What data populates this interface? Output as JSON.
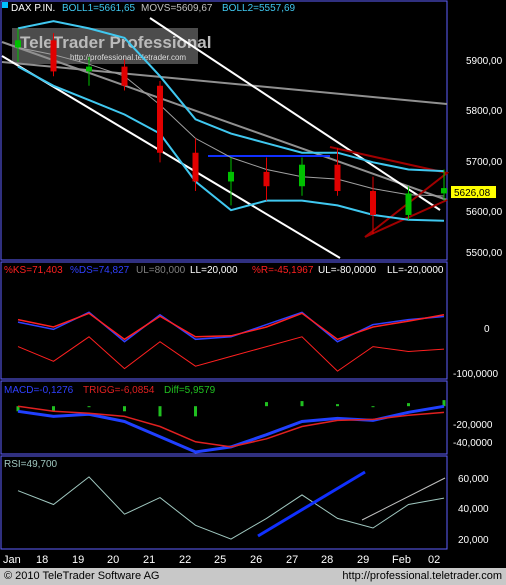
{
  "price_panel": {
    "header_label": "DAX P.IN.",
    "boll1": "BOLL1=5661,65",
    "movs": "MOVS=5609,67",
    "boll2": "BOLL2=5557,69",
    "watermark_title": "TeleTrader Professional",
    "watermark_url": "http://professional.teletrader.com",
    "last_price_label": "5626,08",
    "y_ticks": [
      "5900,00",
      "5800,00",
      "5700,00",
      "5600,00",
      "5500,00"
    ]
  },
  "stoch_panel": {
    "ks": "%KS=71,403",
    "ds": "%DS=74,827",
    "ul": "UL=80,000",
    "ll": "LL=20,000",
    "r": "%R=-45,1967",
    "ul2": "UL=-80,0000",
    "ll2": "LL=-20,0000",
    "y_ticks": [
      "0",
      "-100,0000"
    ]
  },
  "macd_panel": {
    "macd": "MACD=-0,1276",
    "trigg": "TRIGG=-6,0854",
    "diff": "Diff=5,9579",
    "y_ticks": [
      "-20,0000",
      "-40,0000"
    ]
  },
  "rsi_panel": {
    "rsi": "RSI=49,700",
    "y_ticks": [
      "60,000",
      "40,000",
      "20,000"
    ]
  },
  "x_axis": {
    "labels": [
      "Jan",
      "18",
      "19",
      "20",
      "21",
      "22",
      "25",
      "26",
      "27",
      "28",
      "29",
      "Feb",
      "02"
    ]
  },
  "footer": {
    "copyright": "© 2010 TeleTrader Software AG",
    "url": "http://professional.teletrader.com"
  },
  "colors": {
    "boll": "#40c8f0",
    "movs": "#a0a0a0",
    "up_candle": "#00c000",
    "down_candle": "#e00000",
    "trendline_white": "#ffffff",
    "trendline_blue": "#1030ff",
    "triangle": "#a00000",
    "ks": "#3040ff",
    "ds": "#ff2020",
    "macd": "#2040ff",
    "trigg": "#e02020",
    "diff": "#20c020",
    "rsi": "#a0c8c0",
    "last_price_bg": "#ffff00"
  },
  "chart_data": [
    {
      "type": "candlestick",
      "title": "DAX P.IN.",
      "ylim": [
        5480,
        5990
      ],
      "x": [
        "Jan 15",
        "18",
        "19",
        "20",
        "21",
        "22",
        "25",
        "26",
        "27",
        "28",
        "29",
        "Feb 01",
        "02"
      ],
      "ohlc": [
        [
          5920,
          5960,
          5890,
          5935
        ],
        [
          5935,
          5950,
          5860,
          5870
        ],
        [
          5870,
          5900,
          5840,
          5880
        ],
        [
          5880,
          5895,
          5830,
          5840
        ],
        [
          5840,
          5850,
          5680,
          5700
        ],
        [
          5700,
          5730,
          5620,
          5640
        ],
        [
          5640,
          5690,
          5590,
          5660
        ],
        [
          5660,
          5690,
          5600,
          5630
        ],
        [
          5630,
          5690,
          5610,
          5675
        ],
        [
          5675,
          5710,
          5610,
          5620
        ],
        [
          5620,
          5650,
          5530,
          5570
        ],
        [
          5570,
          5630,
          5560,
          5615
        ],
        [
          5615,
          5665,
          5600,
          5626.08
        ]
      ],
      "series": [
        {
          "name": "BOLL1",
          "values": [
            5960,
            5975,
            5960,
            5940,
            5860,
            5770,
            5740,
            5720,
            5700,
            5700,
            5680,
            5665,
            5661.65
          ]
        },
        {
          "name": "MOVS",
          "values": [
            5920,
            5905,
            5885,
            5860,
            5800,
            5730,
            5690,
            5665,
            5650,
            5645,
            5625,
            5612,
            5609.67
          ]
        },
        {
          "name": "BOLL2",
          "values": [
            5880,
            5840,
            5810,
            5780,
            5740,
            5640,
            5580,
            5600,
            5600,
            5590,
            5570,
            5560,
            5557.69
          ]
        }
      ]
    },
    {
      "type": "line",
      "series": [
        {
          "name": "%KS",
          "values": [
            60,
            45,
            80,
            20,
            75,
            25,
            30,
            55,
            80,
            20,
            55,
            65,
            71.403
          ]
        },
        {
          "name": "%DS",
          "values": [
            65,
            50,
            78,
            25,
            72,
            30,
            32,
            50,
            78,
            25,
            50,
            62,
            74.827
          ]
        },
        {
          "name": "%R",
          "values": [
            -40,
            -70,
            -20,
            -85,
            -30,
            -80,
            -60,
            -40,
            -20,
            -90,
            -40,
            -50,
            -45.1967
          ]
        }
      ],
      "ylim": [
        -100,
        100
      ]
    },
    {
      "type": "line",
      "series": [
        {
          "name": "MACD",
          "values": [
            -5,
            -10,
            -8,
            -15,
            -30,
            -45,
            -40,
            -28,
            -15,
            -12,
            -14,
            -6,
            -0.1276
          ]
        },
        {
          "name": "TRIGG",
          "values": [
            0,
            -5,
            -7,
            -10,
            -20,
            -35,
            -40,
            -32,
            -20,
            -14,
            -13,
            -9,
            -6.0854
          ]
        },
        {
          "name": "Diff",
          "values": [
            -5,
            -5,
            -1,
            -5,
            -10,
            -10,
            0,
            4,
            5,
            2,
            -1,
            3,
            5.9579
          ]
        }
      ],
      "ylim": [
        -45,
        10
      ]
    },
    {
      "type": "line",
      "series": [
        {
          "name": "RSI",
          "values": [
            55,
            45,
            65,
            38,
            50,
            30,
            20,
            35,
            52,
            35,
            28,
            45,
            49.7
          ]
        }
      ],
      "ylim": [
        15,
        70
      ]
    }
  ]
}
